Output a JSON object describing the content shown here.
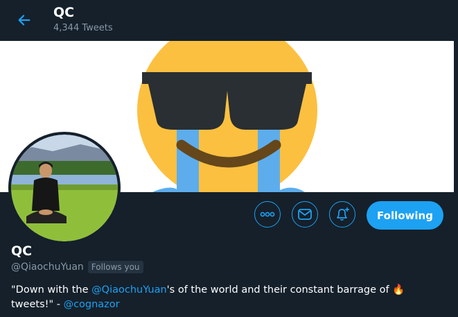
{
  "header": {
    "title": "QC",
    "tweet_count": "4,344 Tweets"
  },
  "profile": {
    "name": "QC",
    "handle": "@QiaochuYuan",
    "follows_you": "Follows you",
    "bio": {
      "part1": "\"Down with the ",
      "mention1": "@QiaochuYuan",
      "part2": "'s of the world and their constant barrage of ",
      "emoji": "🔥",
      "part3": " tweets!\" - ",
      "mention2": "@cognazor"
    }
  },
  "actions": {
    "following_label": "Following",
    "more_icon": "more-icon",
    "message_icon": "envelope-icon",
    "notify_icon": "bell-plus-icon"
  },
  "colors": {
    "background": "#15202b",
    "accent": "#1da1f2",
    "muted": "#8899a6"
  }
}
